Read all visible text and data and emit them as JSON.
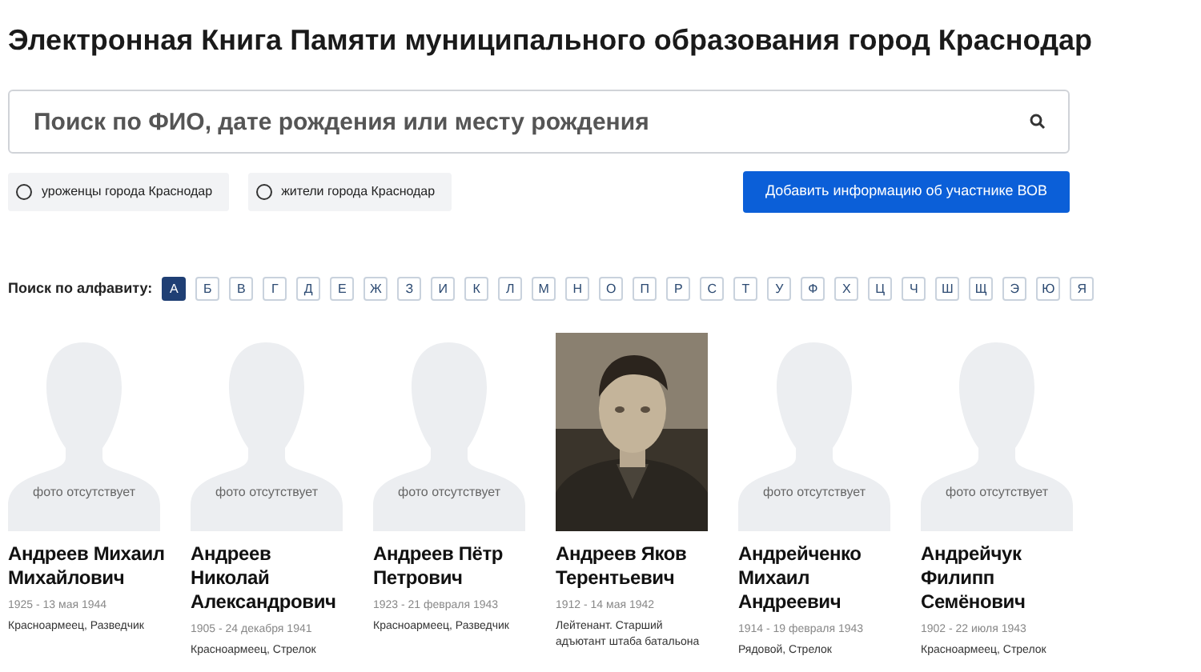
{
  "title": "Электронная Книга Памяти муниципального образования город Краснодар",
  "search": {
    "placeholder": "Поиск по ФИО, дате рождения или месту рождения"
  },
  "filters": [
    {
      "label": "уроженцы города Краснодар",
      "selected": false
    },
    {
      "label": "жители города Краснодар",
      "selected": false
    }
  ],
  "add_button": "Добавить информацию об участнике ВОВ",
  "alphabet": {
    "label": "Поиск по алфавиту:",
    "letters": [
      {
        "letter": "А",
        "selected": true
      },
      {
        "letter": "Б",
        "selected": false
      },
      {
        "letter": "В",
        "selected": false
      },
      {
        "letter": "Г",
        "selected": false
      },
      {
        "letter": "Д",
        "selected": false
      },
      {
        "letter": "Е",
        "selected": false
      },
      {
        "letter": "Ж",
        "selected": false
      },
      {
        "letter": "З",
        "selected": false
      },
      {
        "letter": "И",
        "selected": false
      },
      {
        "letter": "К",
        "selected": false
      },
      {
        "letter": "Л",
        "selected": false
      },
      {
        "letter": "М",
        "selected": false
      },
      {
        "letter": "Н",
        "selected": false
      },
      {
        "letter": "О",
        "selected": false
      },
      {
        "letter": "П",
        "selected": false
      },
      {
        "letter": "Р",
        "selected": false
      },
      {
        "letter": "С",
        "selected": false
      },
      {
        "letter": "Т",
        "selected": false
      },
      {
        "letter": "У",
        "selected": false
      },
      {
        "letter": "Ф",
        "selected": false
      },
      {
        "letter": "Х",
        "selected": false
      },
      {
        "letter": "Ц",
        "selected": false
      },
      {
        "letter": "Ч",
        "selected": false
      },
      {
        "letter": "Ш",
        "selected": false
      },
      {
        "letter": "Щ",
        "selected": false
      },
      {
        "letter": "Э",
        "selected": false
      },
      {
        "letter": "Ю",
        "selected": false
      },
      {
        "letter": "Я",
        "selected": false
      }
    ]
  },
  "people": [
    {
      "kind": "placeholder",
      "photo_text": "фото отсутствует",
      "name": "Андреев Михаил Михайлович",
      "dates": "1925 - 13 мая 1944",
      "role": "Красноармеец, Разведчик"
    },
    {
      "kind": "placeholder",
      "photo_text": "фото отсутствует",
      "name": "Андреев Николай Александрович",
      "dates": "1905 - 24 декабря 1941",
      "role": "Красноармеец, Стрелок"
    },
    {
      "kind": "placeholder",
      "photo_text": "фото отсутствует",
      "name": "Андреев Пётр Петрович",
      "dates": "1923 - 21 февраля 1943",
      "role": "Красноармеец, Разведчик"
    },
    {
      "kind": "picture",
      "name": "Андреев Яков Терентьевич",
      "dates": "1912 - 14 мая 1942",
      "role": "Лейтенант. Старший адъютант штаба батальона"
    },
    {
      "kind": "placeholder",
      "photo_text": "фото отсутствует",
      "name": "Андрейченко Михаил Андреевич",
      "dates": "1914 - 19 февраля 1943",
      "role": "Рядовой, Стрелок"
    },
    {
      "kind": "placeholder",
      "photo_text": "фото отсутствует",
      "name": "Андрейчук Филипп Семёнович",
      "dates": "1902 - 22 июля 1943",
      "role": "Красноармеец, Стрелок"
    }
  ]
}
